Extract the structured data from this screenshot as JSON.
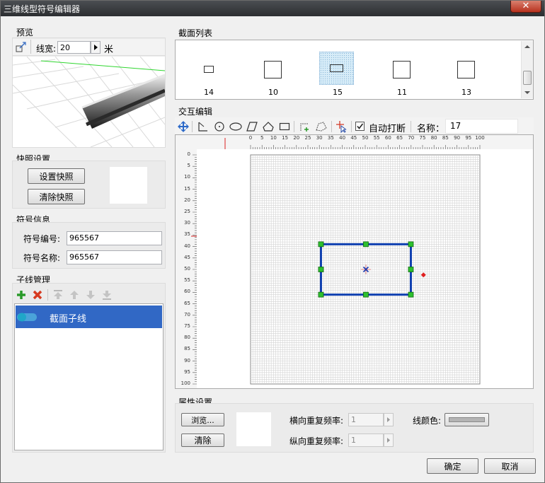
{
  "window": {
    "title": "三维线型符号编辑器",
    "close_label": "✕"
  },
  "preview": {
    "group_label": "预览",
    "width_label": "线宽:",
    "width_value": "20",
    "unit_label": "米"
  },
  "snapshot": {
    "group_label": "快照设置",
    "set_label": "设置快照",
    "clear_label": "清除快照"
  },
  "symbol_info": {
    "group_label": "符号信息",
    "id_label": "符号编号:",
    "id_value": "965567",
    "name_label": "符号名称:",
    "name_value": "965567"
  },
  "subline": {
    "group_label": "子线管理",
    "items": [
      {
        "label": "截面子线",
        "selected": true
      }
    ]
  },
  "section_list": {
    "group_label": "截面列表",
    "items": [
      {
        "label": "14",
        "selected": false
      },
      {
        "label": "10",
        "selected": false
      },
      {
        "label": "15",
        "selected": true
      },
      {
        "label": "11",
        "selected": false
      },
      {
        "label": "13",
        "selected": false
      }
    ]
  },
  "interactive": {
    "group_label": "交互编辑",
    "auto_break_label": "自动打断",
    "auto_break_checked": true,
    "name_label": "名称：",
    "name_value": "17",
    "ruler_ticks": [
      "0",
      "5",
      "10",
      "15",
      "20",
      "25",
      "30",
      "35",
      "40",
      "45",
      "50",
      "55",
      "60",
      "65",
      "70",
      "75",
      "80",
      "85",
      "90",
      "95",
      "100"
    ]
  },
  "properties": {
    "group_label": "属性设置",
    "browse_label": "浏览...",
    "clear_label": "清除",
    "h_repeat_label": "横向重复频率:",
    "h_repeat_value": "1",
    "v_repeat_label": "纵向重复频率:",
    "v_repeat_value": "1",
    "line_color_label": "线颜色:"
  },
  "footer": {
    "ok_label": "确定",
    "cancel_label": "取消"
  },
  "colors": {
    "selection": "#3168c5",
    "shape": "#1040b0",
    "handle": "#2ec02e"
  }
}
